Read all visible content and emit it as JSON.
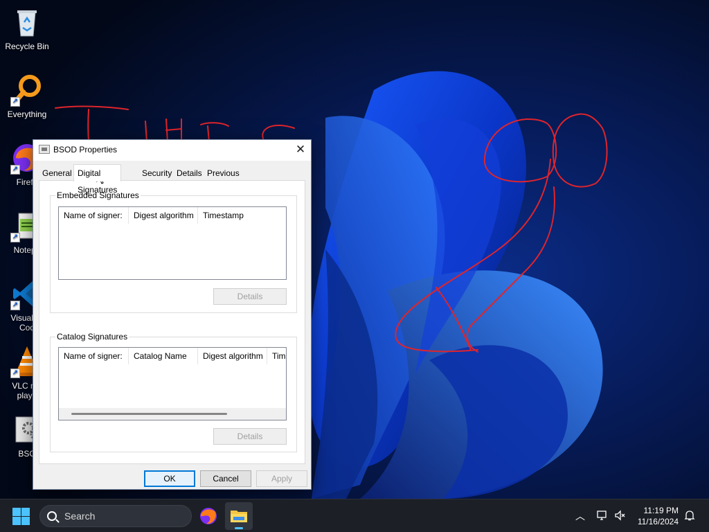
{
  "desktop": {
    "icons": [
      {
        "label": "Recycle Bin",
        "icon": "recycle-bin-icon"
      },
      {
        "label": "Everything",
        "icon": "everything-search-icon"
      },
      {
        "label": "Firefo",
        "icon": "firefox-icon"
      },
      {
        "label": "Notepa",
        "icon": "notepad-icon"
      },
      {
        "label": "Visual St",
        "label2": "Cod",
        "icon": "vscode-icon"
      },
      {
        "label": "VLC me",
        "label2": "playe",
        "icon": "vlc-icon"
      },
      {
        "label": "BSO",
        "icon": "settings-app-icon"
      }
    ]
  },
  "dialog": {
    "title": "BSOD Properties",
    "close": "✕",
    "tabs": [
      "General",
      "Digital Signatures",
      "Security",
      "Details",
      "Previous Versions"
    ],
    "active_tab": "Digital Signatures",
    "embedded": {
      "title": "Embedded Signatures",
      "columns": [
        "Name of signer:",
        "Digest algorithm",
        "Timestamp"
      ],
      "details_button": "Details"
    },
    "catalog": {
      "title": "Catalog Signatures",
      "columns": [
        "Name of signer:",
        "Catalog Name",
        "Digest algorithm",
        "Time"
      ],
      "details_button": "Details"
    },
    "buttons": {
      "ok": "OK",
      "cancel": "Cancel",
      "apply": "Apply"
    }
  },
  "taskbar": {
    "search_placeholder": "Search",
    "time": "11:19 PM",
    "date": "11/16/2024",
    "pinned": [
      "firefox-icon",
      "file-explorer-icon"
    ]
  },
  "colors": {
    "accent": "#0078d7",
    "taskbar": "#1c1f26",
    "annotation": "#e0242b"
  }
}
